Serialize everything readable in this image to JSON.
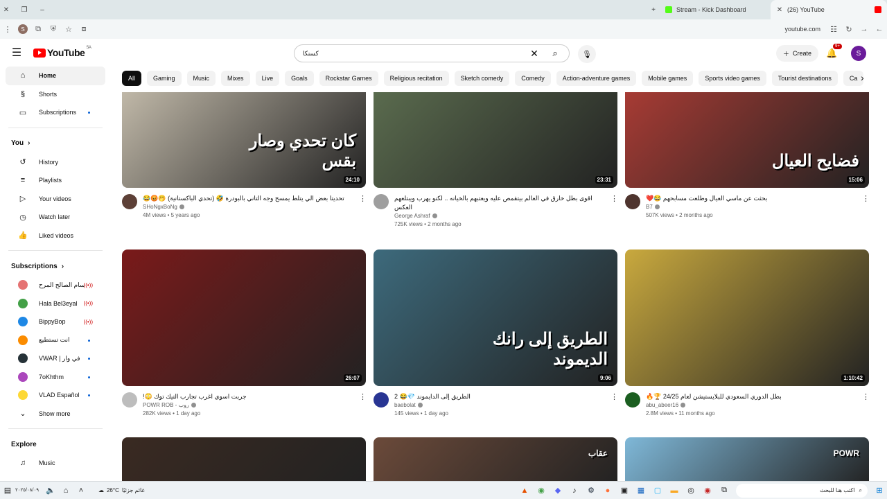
{
  "browser": {
    "tabs": [
      {
        "label": "Stream - Kick Dashboard",
        "color": "#53fc18"
      },
      {
        "label": "(26) YouTube",
        "color": "#ff0000"
      }
    ],
    "url": "youtube.com",
    "profile_initial": "S"
  },
  "header": {
    "logo_text": "YouTube",
    "region": "SA",
    "search_query": "كسنكا",
    "create_label": "Create",
    "notifications": "9+",
    "account_initial": "S"
  },
  "sidebar": {
    "main": [
      {
        "label": "Home",
        "icon": "home-icon"
      },
      {
        "label": "Shorts",
        "icon": "shorts-icon"
      },
      {
        "label": "Subscriptions",
        "icon": "subscriptions-icon"
      }
    ],
    "you_title": "You",
    "you": [
      {
        "label": "History",
        "icon": "history-icon"
      },
      {
        "label": "Playlists",
        "icon": "playlists-icon"
      },
      {
        "label": "Your videos",
        "icon": "your-videos-icon"
      },
      {
        "label": "Watch later",
        "icon": "watch-later-icon"
      },
      {
        "label": "Liked videos",
        "icon": "liked-icon"
      }
    ],
    "subs_title": "Subscriptions",
    "subs": [
      {
        "label": "سام الصالح المرح",
        "color": "#e57373"
      },
      {
        "label": "Hala Bel3eyal",
        "color": "#43a047"
      },
      {
        "label": "BippyBop",
        "color": "#1e88e5"
      },
      {
        "label": "انت تستطيع",
        "color": "#fb8c00"
      },
      {
        "label": "VWAR | في وار",
        "color": "#263238"
      },
      {
        "label": "7oKhthm",
        "color": "#ab47bc"
      },
      {
        "label": "VLAD Español",
        "color": "#fdd835"
      }
    ],
    "show_more": "Show more",
    "explore_title": "Explore",
    "explore": [
      {
        "label": "Music",
        "icon": "music-icon"
      }
    ]
  },
  "chips": [
    "All",
    "Gaming",
    "Music",
    "Mixes",
    "Live",
    "Goals",
    "Rockstar Games",
    "Religious recitation",
    "Sketch comedy",
    "Comedy",
    "Action-adventure games",
    "Mobile games",
    "Sports video games",
    "Tourist destinations",
    "Ca"
  ],
  "videos": [
    {
      "title": "تحديتا بعض الي يتلط يمسح وجه التاني بالبودرة 🤣 (تحدي الباكستانية) 🤭😡😂",
      "channel": "SHoNgxBoNg",
      "stats": "4M views • 5 years ago",
      "duration": "24:10",
      "thumb_text": "كان تحدي وصار بقس",
      "color": "#c0b8a8",
      "avatar": "#5d4037"
    },
    {
      "title": "اقوى بطل خارق في العالم بيتقمص عليه ويعتبهم بالخيانه .. لكنو يهرب ويبتلعهم العكس",
      "channel": "George Ashraf",
      "stats": "725K views • 2 months ago",
      "duration": "23:31",
      "thumb_text": "",
      "color": "#5a6b4e",
      "avatar": "#9e9e9e"
    },
    {
      "title": "بحثت عن ماسي العيال وطلعت مسابحهم 😂❤️",
      "channel": "B7",
      "stats": "507K views • 2 months ago",
      "duration": "15:06",
      "thumb_text": "فضايح العيال",
      "color": "#a73b34",
      "avatar": "#4e342e"
    },
    {
      "title": "جربت اسوي اغرب تجارب التيك توك 😳!",
      "channel": "POWR ROB - روب",
      "stats": "282K views • 1 day ago",
      "duration": "26:07",
      "thumb_text": "",
      "color": "#7a1a1a",
      "avatar": "#bdbdbd"
    },
    {
      "title": "الطريق إلى الدايموند 💎😂 2",
      "channel": "baebolat",
      "stats": "145 views • 1 day ago",
      "duration": "9:06",
      "thumb_text": "الطريق إلى رانك الديموند",
      "color": "#3d6a7c",
      "avatar": "#283593"
    },
    {
      "title": "بطل الدوري السعودي للبلايستيشن لعام 24/25 🏆🔥",
      "channel": "abu_abeer16",
      "stats": "2.8M views • 11 months ago",
      "duration": "1:10:42",
      "thumb_text": "",
      "color": "#c9a93e",
      "avatar": "#1b5e20"
    },
    {
      "title": "",
      "channel": "",
      "stats": "",
      "duration": "",
      "thumb_text": "",
      "color": "#3a2a22",
      "avatar": "#000"
    },
    {
      "title": "",
      "channel": "",
      "stats": "",
      "duration": "",
      "thumb_text": "عقاب",
      "color": "#6b4a3a",
      "avatar": "#000"
    },
    {
      "title": "",
      "channel": "",
      "stats": "",
      "duration": "",
      "thumb_text": "POWR",
      "color": "#7fb8d8",
      "avatar": "#000"
    }
  ],
  "taskbar": {
    "weather": "26°C",
    "weather_label": "غائم جزئيًا",
    "search_placeholder": "اكتب هنا للبحث",
    "date": "٢٠٢٥/٠٨/٠٩"
  }
}
